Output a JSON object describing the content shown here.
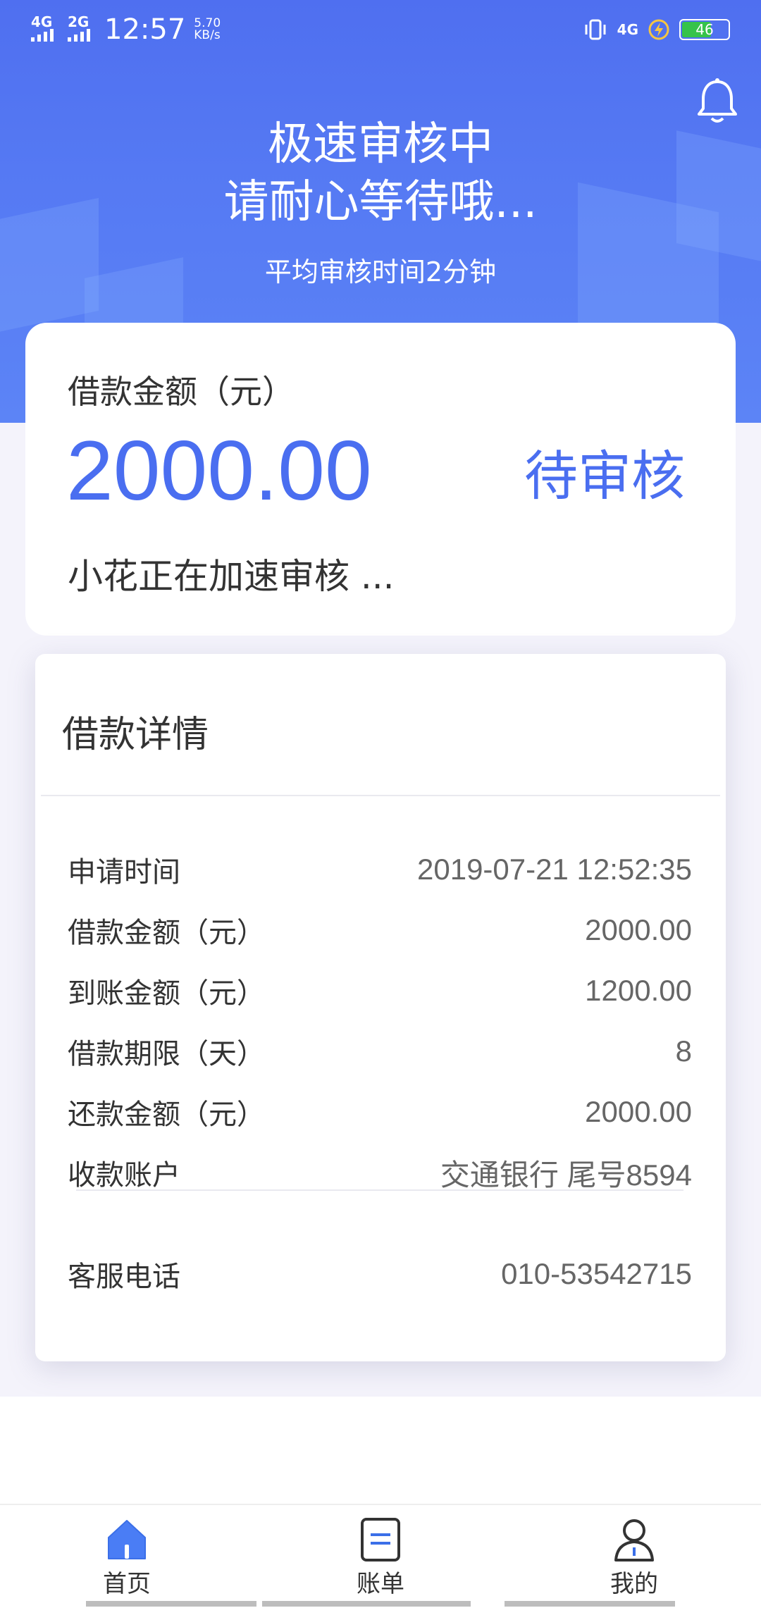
{
  "status_bar": {
    "signal1": "4G",
    "signal2": "2G",
    "time": "12:57",
    "speed_value": "5.70",
    "speed_unit": "KB/s",
    "network": "4G",
    "battery": "46"
  },
  "header": {
    "title_line1": "极速审核中",
    "title_line2": "请耐心等待哦...",
    "subtitle": "平均审核时间2分钟"
  },
  "amount_card": {
    "label": "借款金额（元）",
    "amount": "2000.00",
    "status": "待审核",
    "note": "小花正在加速审核 ..."
  },
  "details": {
    "title": "借款详情",
    "rows": [
      {
        "key": "申请时间",
        "value": "2019-07-21 12:52:35"
      },
      {
        "key": "借款金额（元）",
        "value": "2000.00"
      },
      {
        "key": "到账金额（元）",
        "value": "1200.00"
      },
      {
        "key": "借款期限（天）",
        "value": "8"
      },
      {
        "key": "还款金额（元）",
        "value": "2000.00"
      },
      {
        "key": "收款账户",
        "value": "交通银行 尾号8594"
      }
    ],
    "service": {
      "key": "客服电话",
      "value": "010-53542715"
    }
  },
  "tabs": [
    {
      "label": "首页",
      "icon": "home-icon",
      "active": true
    },
    {
      "label": "账单",
      "icon": "bill-icon",
      "active": false
    },
    {
      "label": "我的",
      "icon": "profile-icon",
      "active": false
    }
  ],
  "colors": {
    "accent": "#4a6ef0",
    "header_bg": "#5579f3"
  }
}
